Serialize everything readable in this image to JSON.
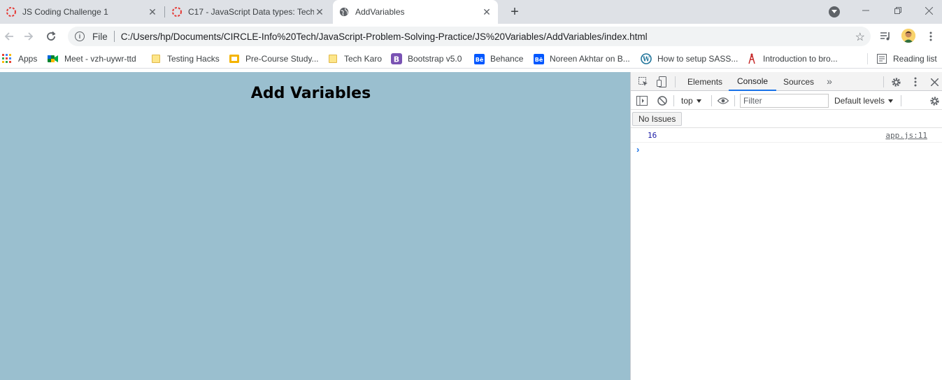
{
  "browser": {
    "tabs": [
      {
        "title": "JS Coding Challenge 1",
        "favicon": "circle-logo-icon",
        "active": false
      },
      {
        "title": "C17 - JavaScript Data types: Tech",
        "favicon": "circle-logo-icon",
        "active": false
      },
      {
        "title": "AddVariables",
        "favicon": "globe-icon",
        "active": true
      }
    ],
    "omnibox": {
      "scheme_label": "File",
      "url": "C:/Users/hp/Documents/CIRCLE-Info%20Tech/JavaScript-Problem-Solving-Practice/JS%20Variables/AddVariables/index.html"
    },
    "bookmarks": [
      {
        "label": "Apps",
        "icon": "apps-grid-icon"
      },
      {
        "label": "Meet - vzh-uywr-ttd",
        "icon": "meet-icon"
      },
      {
        "label": "Testing Hacks",
        "icon": "folder-icon"
      },
      {
        "label": "Pre-Course Study...",
        "icon": "slides-icon"
      },
      {
        "label": "Tech Karo",
        "icon": "folder-icon"
      },
      {
        "label": "Bootstrap v5.0",
        "icon": "bootstrap-icon"
      },
      {
        "label": "Behance",
        "icon": "behance-icon"
      },
      {
        "label": "Noreen Akhtar on B...",
        "icon": "behance-icon"
      },
      {
        "label": "How to setup SASS...",
        "icon": "wordpress-icon"
      },
      {
        "label": "Introduction to bro...",
        "icon": "tower-icon"
      }
    ],
    "reading_list_label": "Reading list"
  },
  "page": {
    "heading": "Add Variables",
    "background_color": "#9abfcf"
  },
  "devtools": {
    "tabs": [
      "Elements",
      "Console",
      "Sources"
    ],
    "active_tab": "Console",
    "context": "top",
    "filter_placeholder": "Filter",
    "levels_label": "Default levels",
    "issues_label": "No Issues",
    "log": {
      "value": "16",
      "source": "app.js:11"
    }
  }
}
